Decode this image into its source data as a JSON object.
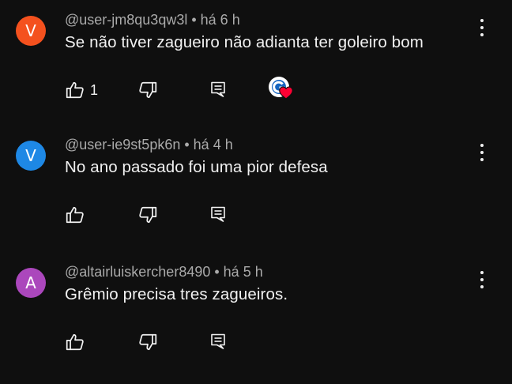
{
  "comments": [
    {
      "avatar_letter": "V",
      "avatar_color": "#f4511e",
      "author": "@user-jm8qu3qw3l",
      "separator": "•",
      "time": "há 6 h",
      "text": "Se não tiver zagueiro não adianta ter goleiro bom",
      "likes": "1",
      "hearted_by_creator": true
    },
    {
      "avatar_letter": "V",
      "avatar_color": "#1e88e5",
      "author": "@user-ie9st5pk6n",
      "separator": "•",
      "time": "há 4 h",
      "text": "No ano passado foi uma pior defesa",
      "likes": "",
      "hearted_by_creator": false
    },
    {
      "avatar_letter": "A",
      "avatar_color": "#ab47bc",
      "author": "@altairluiskercher8490",
      "separator": "•",
      "time": "há 5 h",
      "text": "Grêmio precisa tres zagueiros.",
      "likes": "",
      "hearted_by_creator": false
    }
  ],
  "icons": {
    "like": "thumbs-up-icon",
    "dislike": "thumbs-down-icon",
    "reply": "reply-icon",
    "more": "more-vertical-icon",
    "heart": "heart-icon"
  },
  "colors": {
    "background": "#0f0f0f",
    "text_primary": "#f1f1f1",
    "text_secondary": "#aaaaaa",
    "heart": "#ff0033"
  }
}
